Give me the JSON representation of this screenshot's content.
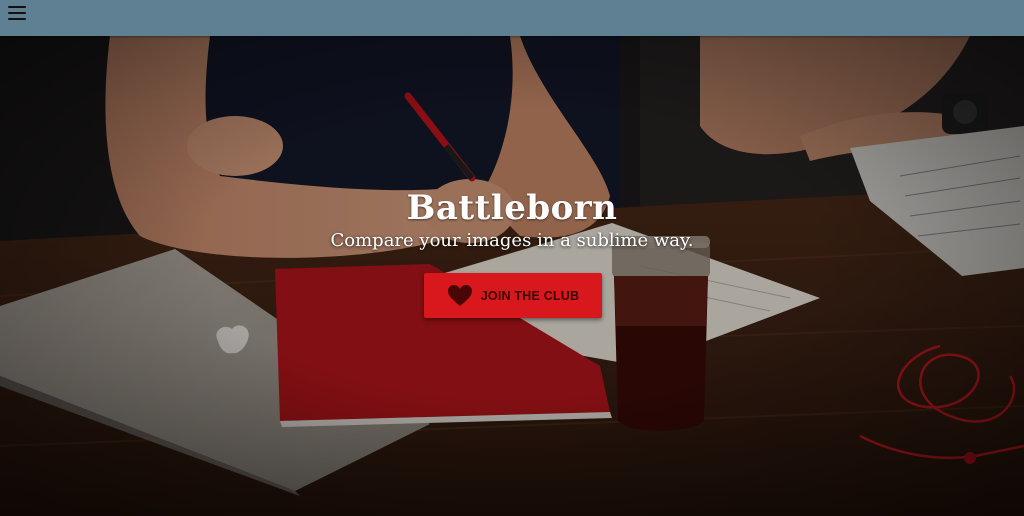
{
  "navbar": {
    "background": "#5f7f92",
    "menu_icon": "hamburger-menu-icon"
  },
  "hero": {
    "title": "Battleborn",
    "subtitle": "Compare your images in a sublime way.",
    "cta": {
      "label": "JOIN THE CLUB",
      "icon": "heart-icon",
      "color": "#d8181c"
    }
  }
}
